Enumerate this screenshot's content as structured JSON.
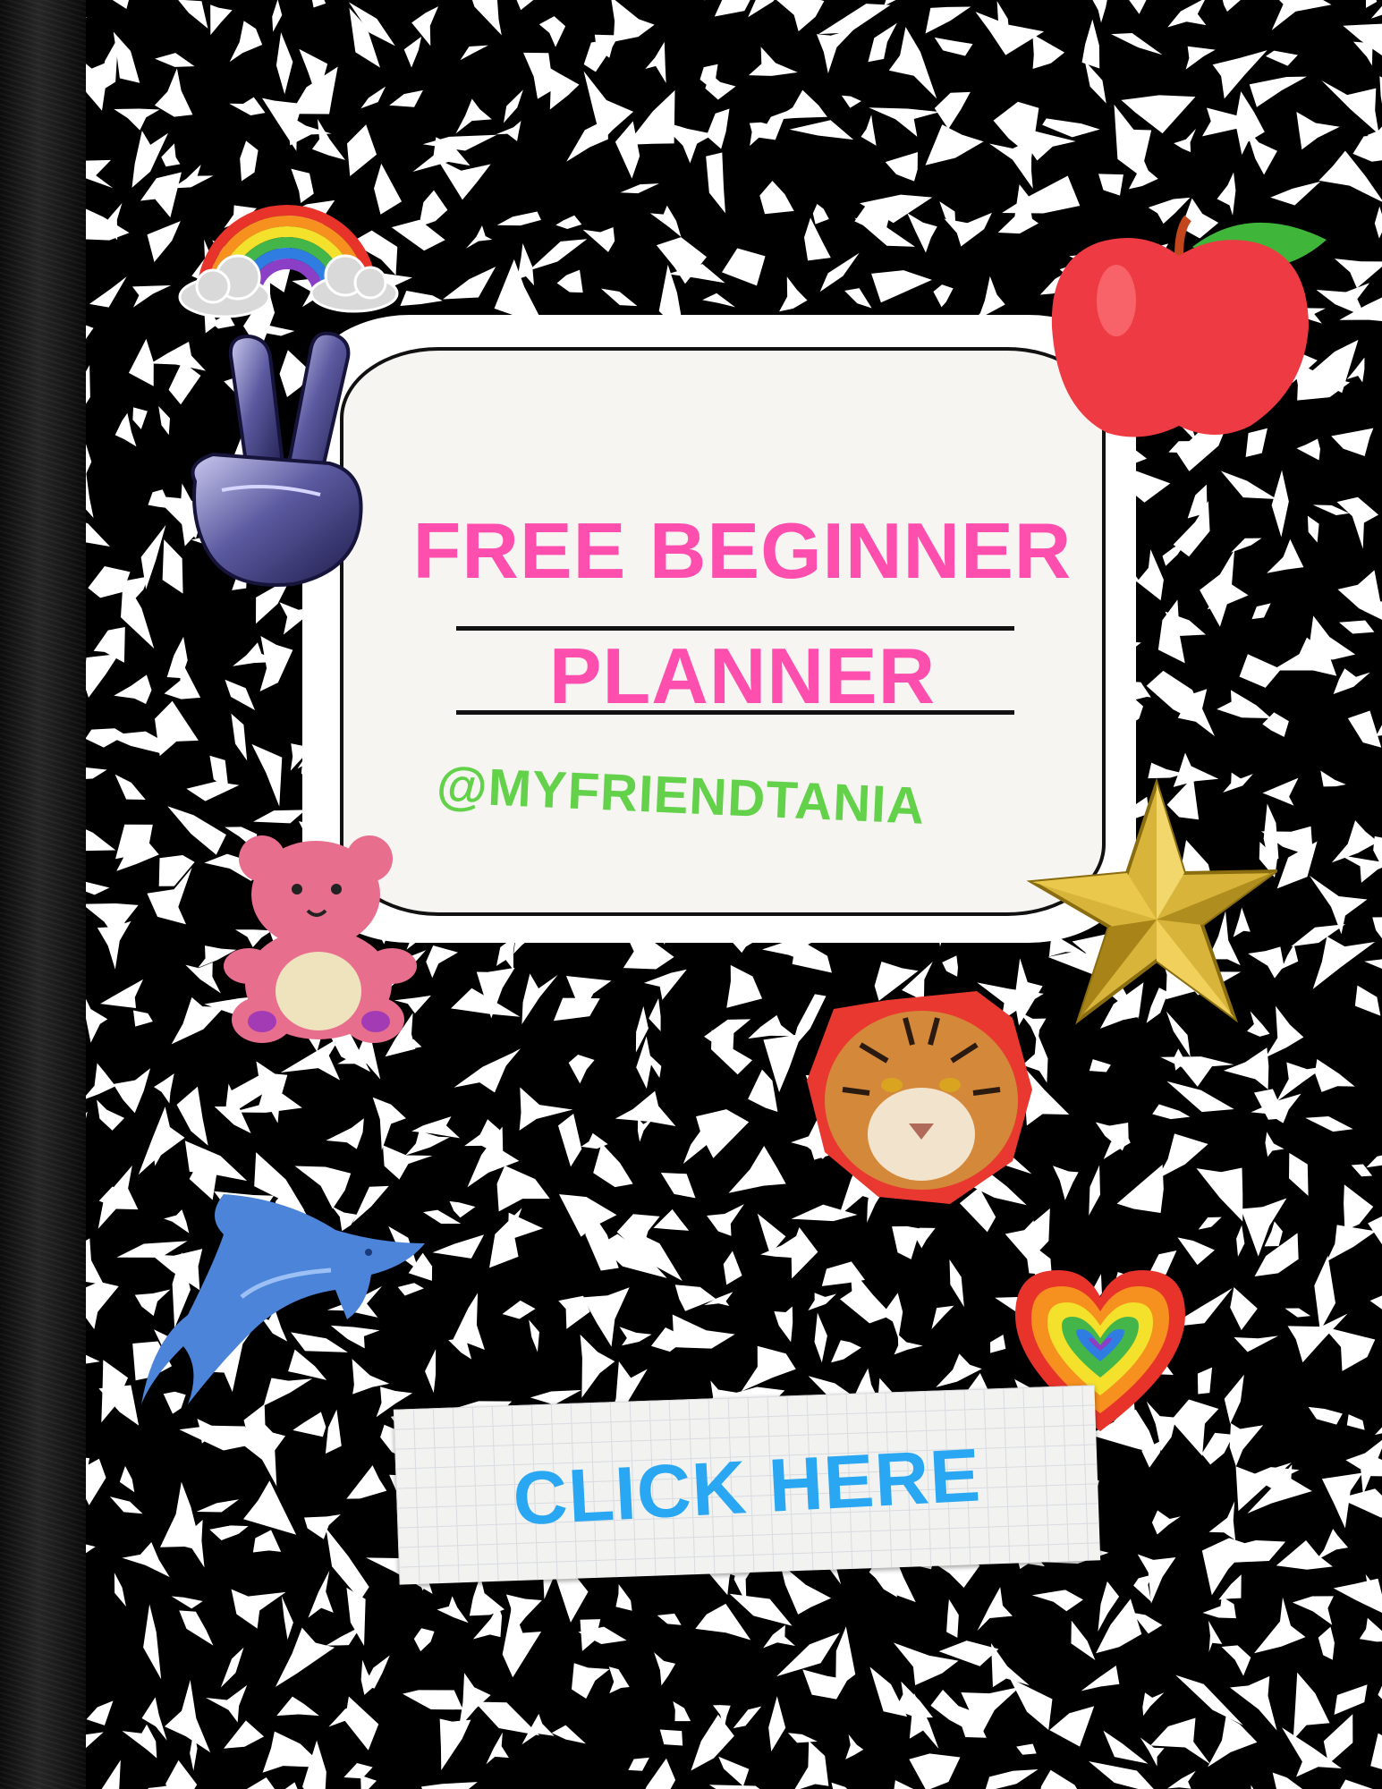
{
  "cover": {
    "title_line1": "FREE BEGINNER",
    "title_line2": "PLANNER",
    "handle": "@MYFRIENDTANIA",
    "cta_label": "CLICK HERE"
  },
  "colors": {
    "title": "#ff4fae",
    "handle": "#63d24a",
    "cta": "#2aa7f2",
    "marble_dark": "#000000",
    "marble_light": "#ffffff"
  },
  "stickers": [
    "rainbow-icon",
    "peace-sign-hand-icon",
    "apple-icon",
    "teddy-bear-icon",
    "gold-star-icon",
    "tiger-icon",
    "dolphin-icon",
    "rainbow-heart-icon"
  ]
}
